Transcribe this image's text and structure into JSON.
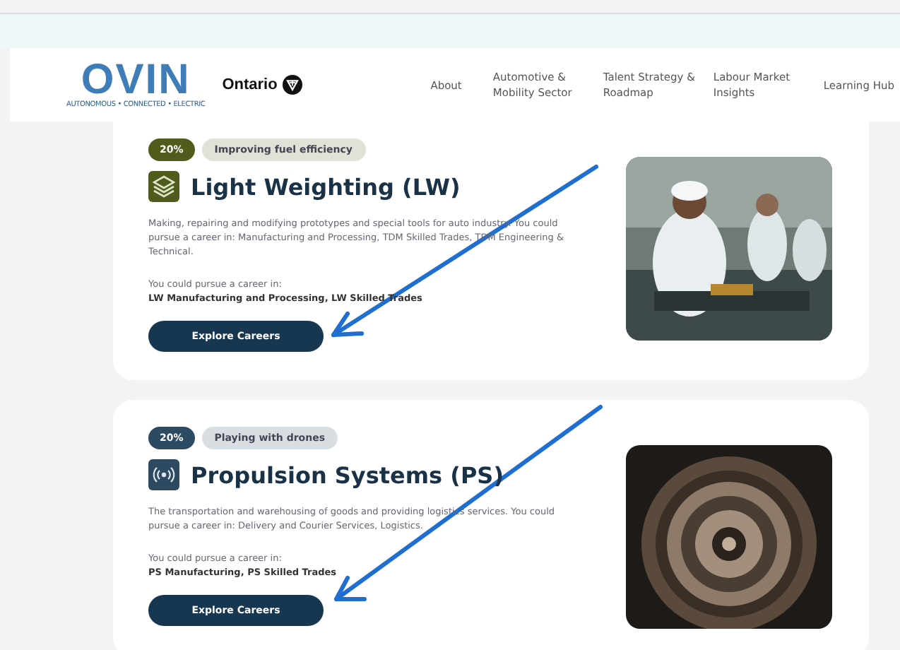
{
  "header": {
    "logo": "OVIN",
    "logo_tagline": "AUTONOMOUS • CONNECTED • ELECTRIC",
    "partner": "Ontario",
    "nav": [
      {
        "label": "About"
      },
      {
        "label": "Automotive & Mobility Sector"
      },
      {
        "label": "Talent Strategy & Roadmap"
      },
      {
        "label": "Labour Market Insights"
      },
      {
        "label": "Learning Hub"
      }
    ]
  },
  "cards": [
    {
      "percent": "20%",
      "tag": "Improving fuel efficiency",
      "color": "#4f5c1c",
      "kind": "layers",
      "title": "Light Weighting (LW)",
      "description": "Making, repairing and modifying prototypes and special tools for auto industry. You could pursue a career in: Manufacturing and Processing, TDM Skilled Trades, TDM Engineering & Technical.",
      "careers_label": "You could pursue a career in:",
      "careers": "LW Manufacturing and Processing, LW Skilled Trades",
      "button": "Explore Careers"
    },
    {
      "percent": "20%",
      "tag": "Playing with drones",
      "color": "#2e4a60",
      "kind": "signal",
      "title": "Propulsion Systems (PS)",
      "description": "The transportation and warehousing of goods and providing logistics services. You could pursue a career in: Delivery and Courier Services, Logistics.",
      "careers_label": "You could pursue a career in:",
      "careers": "PS Manufacturing, PS Skilled Trades",
      "button": "Explore Careers"
    }
  ]
}
